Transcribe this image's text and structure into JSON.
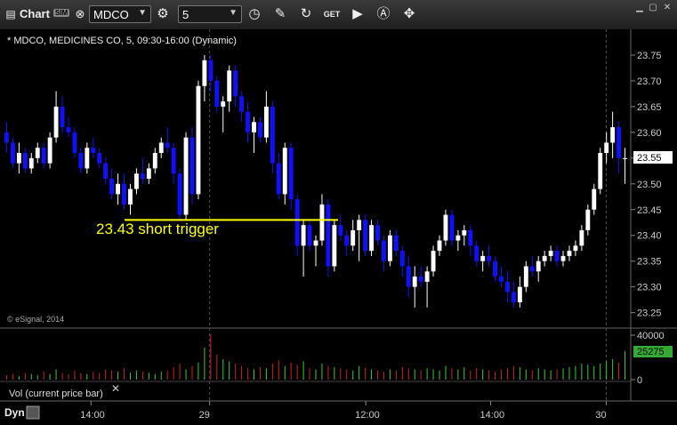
{
  "toolbar": {
    "app_label": "Chart",
    "sim_badge": "SIM",
    "symbol": "MDCO",
    "interval": "5",
    "icons": [
      "chart-icon",
      "link-icon",
      "settings-icon",
      "clock-icon",
      "pencil-icon",
      "refresh-icon",
      "get-icon",
      "play-icon",
      "alert-icon",
      "tools-icon"
    ],
    "window_buttons": [
      "minimize-icon",
      "maximize-icon",
      "close-icon"
    ]
  },
  "chart_header": "* MDCO, MEDICINES CO, 5, 09:30-16:00 (Dynamic)",
  "copyright": "© eSignal, 2014",
  "annotation": "23.43 short trigger",
  "volume_label": "Vol (current price bar)",
  "dyn_label": "Dyn",
  "colors": {
    "up": "#ffffff",
    "down": "#1010ff",
    "trigger_line": "#ffff00",
    "vol_up": "#33cc33",
    "vol_down": "#cc2222",
    "price_marker": "#ffffff",
    "vol_marker": "#33aa33"
  },
  "chart_data": {
    "type": "candlestick",
    "price_axis": {
      "ticks": [
        23.25,
        23.3,
        23.35,
        23.4,
        23.45,
        23.5,
        23.55,
        23.6,
        23.65,
        23.7,
        23.75
      ],
      "range": [
        23.22,
        23.8
      ]
    },
    "last_price_label": "23.55",
    "volume_axis": {
      "ticks": [
        "40000",
        "0"
      ],
      "range": [
        0,
        42000
      ]
    },
    "last_volume_label": "25275",
    "time_labels": [
      "14:00",
      "29",
      "12:00",
      "14:00",
      "30"
    ],
    "trigger_level": 23.43,
    "candles": [
      [
        23.6,
        23.62,
        23.56,
        23.58
      ],
      [
        23.58,
        23.59,
        23.53,
        23.54
      ],
      [
        23.54,
        23.58,
        23.52,
        23.56
      ],
      [
        23.56,
        23.57,
        23.52,
        23.53
      ],
      [
        23.53,
        23.56,
        23.52,
        23.55
      ],
      [
        23.55,
        23.58,
        23.54,
        23.57
      ],
      [
        23.57,
        23.58,
        23.53,
        23.54
      ],
      [
        23.54,
        23.6,
        23.53,
        23.59
      ],
      [
        23.59,
        23.68,
        23.58,
        23.65
      ],
      [
        23.65,
        23.67,
        23.6,
        23.61
      ],
      [
        23.61,
        23.63,
        23.59,
        23.6
      ],
      [
        23.6,
        23.61,
        23.55,
        23.56
      ],
      [
        23.56,
        23.57,
        23.52,
        23.53
      ],
      [
        23.53,
        23.58,
        23.52,
        23.57
      ],
      [
        23.57,
        23.59,
        23.55,
        23.56
      ],
      [
        23.56,
        23.57,
        23.53,
        23.54
      ],
      [
        23.54,
        23.55,
        23.5,
        23.51
      ],
      [
        23.51,
        23.53,
        23.47,
        23.48
      ],
      [
        23.48,
        23.52,
        23.46,
        23.5
      ],
      [
        23.5,
        23.52,
        23.45,
        23.46
      ],
      [
        23.46,
        23.5,
        23.44,
        23.49
      ],
      [
        23.49,
        23.53,
        23.48,
        23.52
      ],
      [
        23.52,
        23.55,
        23.5,
        23.51
      ],
      [
        23.51,
        23.54,
        23.5,
        23.53
      ],
      [
        23.53,
        23.57,
        23.52,
        23.56
      ],
      [
        23.56,
        23.59,
        23.55,
        23.58
      ],
      [
        23.58,
        23.61,
        23.56,
        23.57
      ],
      [
        23.57,
        23.58,
        23.5,
        23.52
      ],
      [
        23.52,
        23.53,
        23.43,
        23.44
      ],
      [
        23.44,
        23.6,
        23.43,
        23.59
      ],
      [
        23.59,
        23.61,
        23.46,
        23.48
      ],
      [
        23.48,
        23.7,
        23.47,
        23.69
      ],
      [
        23.69,
        23.75,
        23.66,
        23.74
      ],
      [
        23.74,
        23.75,
        23.68,
        23.7
      ],
      [
        23.7,
        23.71,
        23.64,
        23.65
      ],
      [
        23.65,
        23.67,
        23.6,
        23.66
      ],
      [
        23.66,
        23.73,
        23.64,
        23.72
      ],
      [
        23.72,
        23.73,
        23.65,
        23.67
      ],
      [
        23.67,
        23.68,
        23.62,
        23.64
      ],
      [
        23.64,
        23.66,
        23.58,
        23.6
      ],
      [
        23.6,
        23.63,
        23.56,
        23.62
      ],
      [
        23.62,
        23.63,
        23.58,
        23.59
      ],
      [
        23.59,
        23.68,
        23.58,
        23.65
      ],
      [
        23.65,
        23.66,
        23.52,
        23.54
      ],
      [
        23.54,
        23.56,
        23.47,
        23.48
      ],
      [
        23.48,
        23.58,
        23.46,
        23.57
      ],
      [
        23.57,
        23.58,
        23.45,
        23.47
      ],
      [
        23.47,
        23.48,
        23.36,
        23.38
      ],
      [
        23.38,
        23.43,
        23.32,
        23.42
      ],
      [
        23.42,
        23.43,
        23.37,
        23.38
      ],
      [
        23.38,
        23.4,
        23.34,
        23.39
      ],
      [
        23.39,
        23.48,
        23.38,
        23.46
      ],
      [
        23.46,
        23.47,
        23.32,
        23.34
      ],
      [
        23.34,
        23.43,
        23.33,
        23.42
      ],
      [
        23.42,
        23.44,
        23.39,
        23.4
      ],
      [
        23.4,
        23.41,
        23.36,
        23.38
      ],
      [
        23.38,
        23.43,
        23.37,
        23.41
      ],
      [
        23.41,
        23.44,
        23.35,
        23.43
      ],
      [
        23.43,
        23.44,
        23.36,
        23.37
      ],
      [
        23.37,
        23.43,
        23.36,
        23.42
      ],
      [
        23.42,
        23.43,
        23.38,
        23.39
      ],
      [
        23.39,
        23.4,
        23.33,
        23.35
      ],
      [
        23.35,
        23.41,
        23.34,
        23.4
      ],
      [
        23.4,
        23.41,
        23.36,
        23.37
      ],
      [
        23.37,
        23.38,
        23.32,
        23.34
      ],
      [
        23.34,
        23.36,
        23.28,
        23.3
      ],
      [
        23.3,
        23.34,
        23.26,
        23.32
      ],
      [
        23.32,
        23.34,
        23.3,
        23.31
      ],
      [
        23.31,
        23.34,
        23.26,
        23.33
      ],
      [
        23.33,
        23.38,
        23.32,
        23.37
      ],
      [
        23.37,
        23.4,
        23.36,
        23.39
      ],
      [
        23.39,
        23.45,
        23.38,
        23.44
      ],
      [
        23.44,
        23.45,
        23.38,
        23.39
      ],
      [
        23.39,
        23.41,
        23.37,
        23.4
      ],
      [
        23.4,
        23.42,
        23.38,
        23.41
      ],
      [
        23.41,
        23.42,
        23.36,
        23.38
      ],
      [
        23.38,
        23.39,
        23.34,
        23.35
      ],
      [
        23.35,
        23.37,
        23.33,
        23.36
      ],
      [
        23.36,
        23.38,
        23.34,
        23.35
      ],
      [
        23.35,
        23.36,
        23.31,
        23.32
      ],
      [
        23.32,
        23.34,
        23.3,
        23.31
      ],
      [
        23.31,
        23.33,
        23.27,
        23.29
      ],
      [
        23.29,
        23.31,
        23.26,
        23.27
      ],
      [
        23.27,
        23.32,
        23.26,
        23.3
      ],
      [
        23.3,
        23.35,
        23.29,
        23.34
      ],
      [
        23.34,
        23.36,
        23.32,
        23.33
      ],
      [
        23.33,
        23.36,
        23.31,
        23.35
      ],
      [
        23.35,
        23.37,
        23.34,
        23.36
      ],
      [
        23.36,
        23.38,
        23.35,
        23.37
      ],
      [
        23.37,
        23.38,
        23.34,
        23.35
      ],
      [
        23.35,
        23.37,
        23.34,
        23.36
      ],
      [
        23.36,
        23.38,
        23.35,
        23.37
      ],
      [
        23.37,
        23.39,
        23.36,
        23.38
      ],
      [
        23.38,
        23.42,
        23.37,
        23.41
      ],
      [
        23.41,
        23.46,
        23.4,
        23.45
      ],
      [
        23.45,
        23.5,
        23.44,
        23.49
      ],
      [
        23.49,
        23.57,
        23.48,
        23.56
      ],
      [
        23.56,
        23.6,
        23.54,
        23.58
      ],
      [
        23.58,
        23.64,
        23.55,
        23.61
      ],
      [
        23.61,
        23.62,
        23.52,
        23.55
      ],
      [
        23.55,
        23.57,
        23.5,
        23.55
      ]
    ],
    "volume": [
      4,
      5,
      3,
      6,
      5,
      4,
      7,
      5,
      9,
      6,
      5,
      8,
      6,
      5,
      7,
      6,
      9,
      8,
      7,
      10,
      6,
      8,
      7,
      6,
      5,
      7,
      8,
      11,
      14,
      9,
      12,
      15,
      28,
      40,
      22,
      18,
      16,
      14,
      12,
      10,
      9,
      11,
      10,
      14,
      17,
      12,
      15,
      13,
      16,
      10,
      9,
      14,
      12,
      11,
      10,
      9,
      8,
      12,
      10,
      9,
      8,
      7,
      9,
      8,
      11,
      10,
      9,
      8,
      10,
      9,
      8,
      12,
      10,
      9,
      11,
      8,
      10,
      9,
      8,
      7,
      9,
      10,
      12,
      11,
      9,
      8,
      10,
      9,
      8,
      9,
      10,
      11,
      12,
      14,
      13,
      12,
      14,
      16,
      18,
      15,
      25
    ]
  }
}
